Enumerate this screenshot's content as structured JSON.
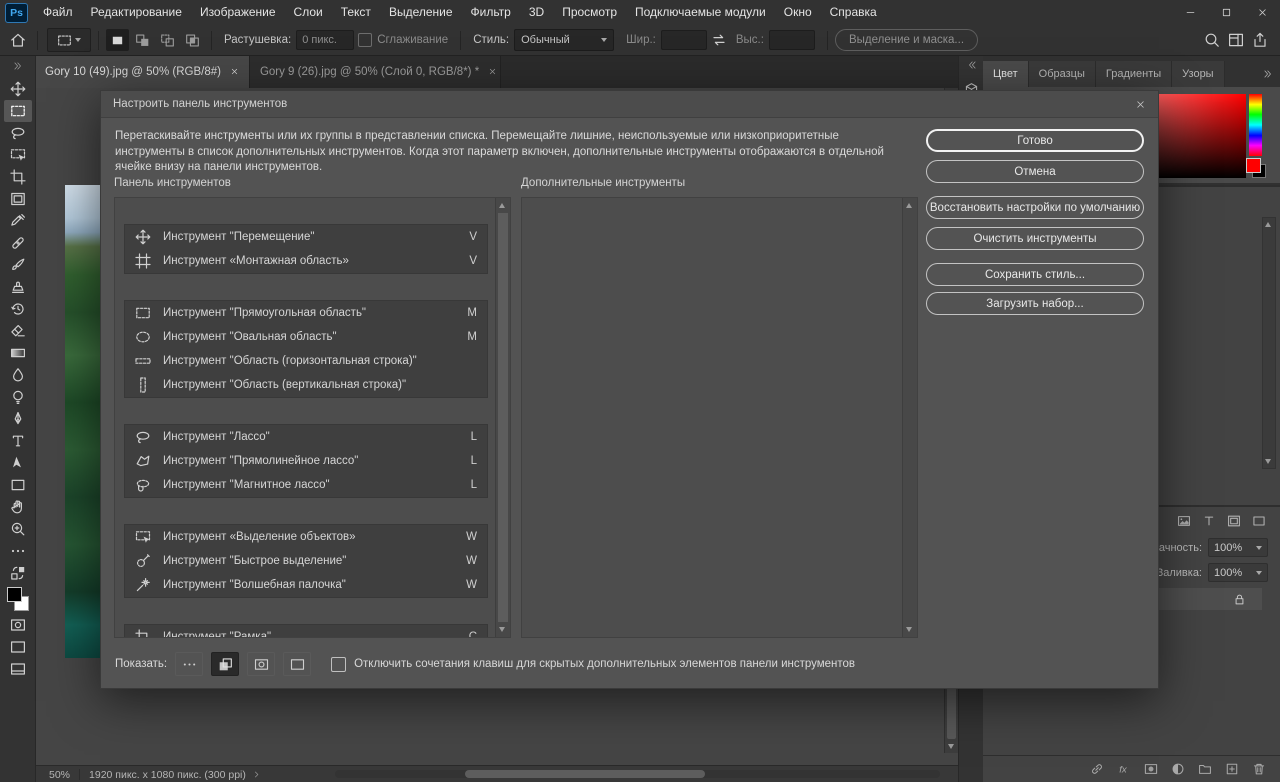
{
  "menubar": {
    "logo": "Ps",
    "items": [
      "Файл",
      "Редактирование",
      "Изображение",
      "Слои",
      "Текст",
      "Выделение",
      "Фильтр",
      "3D",
      "Просмотр",
      "Подключаемые модули",
      "Окно",
      "Справка"
    ],
    "window_controls": [
      "win-min-icon",
      "win-max-icon",
      "win-close-icon"
    ]
  },
  "options_bar": {
    "tool_preview_icon": "rect-marquee-icon",
    "mode_icons": [
      "sel-new-icon",
      "sel-add-icon",
      "sel-sub-icon",
      "sel-intersect-icon"
    ],
    "feather_label": "Растушевка:",
    "feather_value": "0 пикс.",
    "antialias_label": "Сглаживание",
    "style_label": "Стиль:",
    "style_value": "Обычный",
    "width_label": "Шир.:",
    "height_label": "Выс.:",
    "select_and_mask_label": "Выделение и маска...",
    "right_icons": [
      "search-icon",
      "workspace-icon",
      "share-icon"
    ]
  },
  "document_tabs": [
    {
      "title": "Gory 10 (49).jpg @ 50% (RGB/8#)",
      "active": true
    },
    {
      "title": "Gory 9 (26).jpg @ 50% (Слой 0, RGB/8*) *",
      "active": false
    }
  ],
  "toolbar": {
    "tools": [
      {
        "icon": "move-icon"
      },
      {
        "icon": "rect-marquee-icon",
        "selected": true
      },
      {
        "icon": "lasso-icon"
      },
      {
        "icon": "object-select-icon"
      },
      {
        "icon": "crop-icon"
      },
      {
        "icon": "frame-icon"
      },
      {
        "icon": "eyedropper-icon"
      },
      {
        "icon": "healing-icon"
      },
      {
        "icon": "brush-icon"
      },
      {
        "icon": "stamp-icon"
      },
      {
        "icon": "history-brush-icon"
      },
      {
        "icon": "eraser-icon"
      },
      {
        "icon": "gradient-icon"
      },
      {
        "icon": "blur-icon"
      },
      {
        "icon": "dodge-icon"
      },
      {
        "icon": "pen-icon"
      },
      {
        "icon": "type-icon"
      },
      {
        "icon": "path-select-icon"
      },
      {
        "icon": "shape-icon"
      },
      {
        "icon": "hand-icon"
      },
      {
        "icon": "zoom-icon"
      },
      {
        "icon": "ellipsis-icon"
      },
      {
        "icon": "swap-colors-icon"
      },
      {
        "icon": "fgbg-swatch"
      },
      {
        "icon": "quick-mask-icon"
      },
      {
        "icon": "screen-mode-icon"
      },
      {
        "icon": "screen-mode-alt-icon"
      }
    ]
  },
  "dialog": {
    "title": "Настроить панель инструментов",
    "description": "Перетаскивайте инструменты или их группы в представлении списка. Перемещайте лишние, неиспользуемые или низкоприоритетные инструменты в список дополнительных инструментов. Когда этот параметр включен, дополнительные инструменты отображаются в отдельной ячейке внизу на панели инструментов.",
    "left_list_title": "Панель инструментов",
    "right_list_title": "Дополнительные инструменты",
    "buttons": [
      "Готово",
      "Отмена",
      "Восстановить настройки по умолчанию",
      "Очистить инструменты",
      "Сохранить стиль...",
      "Загрузить набор..."
    ],
    "tool_groups": [
      {
        "tools": [
          {
            "icon": "move-icon",
            "name": "Инструмент \"Перемещение\"",
            "shortcut": "V"
          },
          {
            "icon": "artboard-icon",
            "name": "Инструмент «Монтажная область»",
            "shortcut": "V"
          }
        ]
      },
      {
        "tools": [
          {
            "icon": "rect-marquee-icon",
            "name": "Инструмент \"Прямоугольная область\"",
            "shortcut": "M"
          },
          {
            "icon": "ellipse-marquee-icon",
            "name": "Инструмент \"Овальная область\"",
            "shortcut": "M"
          },
          {
            "icon": "row-marquee-icon",
            "name": "Инструмент \"Область (горизонтальная строка)\"",
            "shortcut": ""
          },
          {
            "icon": "column-marquee-icon",
            "name": "Инструмент \"Область (вертикальная строка)\"",
            "shortcut": ""
          }
        ]
      },
      {
        "tools": [
          {
            "icon": "lasso-icon",
            "name": "Инструмент \"Лассо\"",
            "shortcut": "L"
          },
          {
            "icon": "poly-lasso-icon",
            "name": "Инструмент \"Прямолинейное лассо\"",
            "shortcut": "L"
          },
          {
            "icon": "magnetic-lasso-icon",
            "name": "Инструмент \"Магнитное лассо\"",
            "shortcut": "L"
          }
        ]
      },
      {
        "tools": [
          {
            "icon": "object-select-icon",
            "name": "Инструмент «Выделение объектов»",
            "shortcut": "W"
          },
          {
            "icon": "quick-select-icon",
            "name": "Инструмент \"Быстрое выделение\"",
            "shortcut": "W"
          },
          {
            "icon": "magic-wand-icon",
            "name": "Инструмент \"Волшебная палочка\"",
            "shortcut": "W"
          }
        ]
      },
      {
        "tools": [
          {
            "icon": "crop-icon",
            "name": "Инструмент \"Рамка\"",
            "shortcut": "C"
          }
        ]
      }
    ],
    "footer": {
      "show_label": "Показать:",
      "icons": [
        "ellipsis-icon",
        "swatch-overlap-icon",
        "quick-mask-icon",
        "screen-mode-icon"
      ],
      "checkbox_label": "Отключить сочетания клавиш для скрытых дополнительных элементов панели инструментов"
    }
  },
  "right_panel": {
    "tabs": [
      {
        "label": "Цвет",
        "active": true
      },
      {
        "label": "Образцы",
        "active": false
      },
      {
        "label": "Градиенты",
        "active": false
      },
      {
        "label": "Узоры",
        "active": false
      }
    ],
    "layers": {
      "filter_icons": [
        "image-icon",
        "type-small-icon",
        "frame-icon",
        "shape-icon"
      ],
      "opacity_label": "Непрозрачность:",
      "opacity_value": "100%",
      "fill_label": "Заливка:",
      "fill_value": "100%",
      "bottom_icons": [
        "link-icon",
        "fx-icon",
        "mask-icon",
        "adjust-icon",
        "folder-icon",
        "new-layer-icon",
        "trash-icon"
      ]
    }
  },
  "status_bar": {
    "zoom": "50%",
    "doc_info": "1920 пикс. x 1080 пикс. (300 ppi)"
  },
  "colors": {
    "foreground": "#000000",
    "background": "#ffffff",
    "color_panel_color": "#ff0000"
  }
}
